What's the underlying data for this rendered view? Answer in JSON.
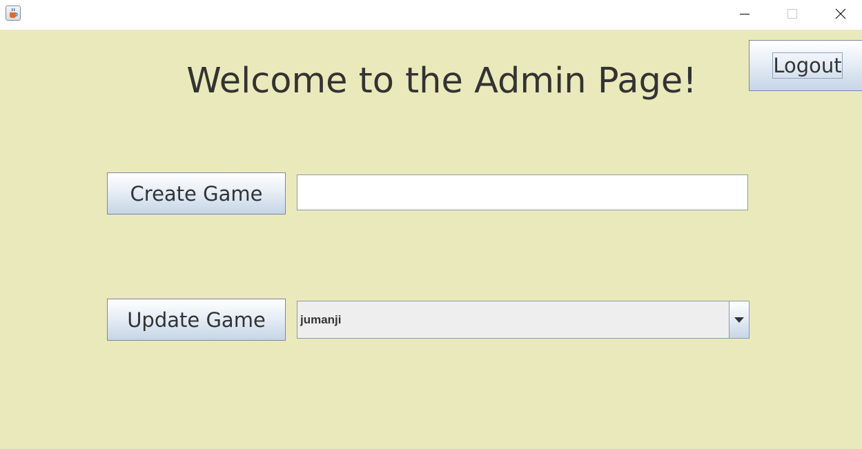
{
  "window": {
    "icon": "java-cup-icon",
    "controls": {
      "minimize": "minimize-icon",
      "maximize": "maximize-icon",
      "close": "close-icon"
    }
  },
  "header": {
    "title": "Welcome to the Admin Page!",
    "logout_label": "Logout"
  },
  "create_game": {
    "button_label": "Create Game",
    "input_value": ""
  },
  "update_game": {
    "button_label": "Update Game",
    "selected_game": "jumanji"
  },
  "colors": {
    "background": "#eae9bb",
    "titlebar": "#ffffff",
    "text": "#333333",
    "button_border": "#7a8a9e",
    "combo_background": "#eeeeee"
  }
}
